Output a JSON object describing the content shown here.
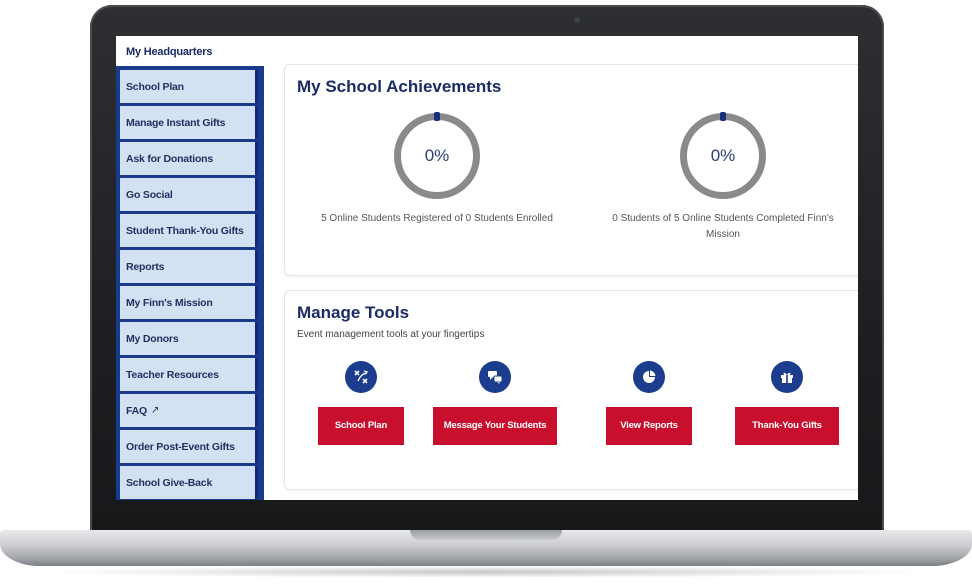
{
  "sidebar": {
    "header": "My Headquarters",
    "items": [
      {
        "label": "School Plan"
      },
      {
        "label": "Manage Instant Gifts"
      },
      {
        "label": "Ask for Donations"
      },
      {
        "label": "Go Social"
      },
      {
        "label": "Student Thank-You Gifts"
      },
      {
        "label": "Reports"
      },
      {
        "label": "My Finn's Mission"
      },
      {
        "label": "My Donors"
      },
      {
        "label": "Teacher Resources"
      },
      {
        "label": "FAQ",
        "icon": "external-link-icon"
      },
      {
        "label": "Order Post-Event Gifts"
      },
      {
        "label": "School Give-Back"
      }
    ]
  },
  "achievements": {
    "title": "My School Achievements",
    "stats": [
      {
        "percent": "0%",
        "label": "5 Online Students Registered of 0 Students Enrolled"
      },
      {
        "percent": "0%",
        "label": "0 Students of 5 Online Students Completed Finn's Mission"
      }
    ]
  },
  "tools": {
    "title": "Manage Tools",
    "subtitle": "Event management tools at your fingertips",
    "items": [
      {
        "label": "School Plan",
        "icon": "strategy-icon"
      },
      {
        "label": "Message Your Students",
        "icon": "chat-bubbles-icon"
      },
      {
        "label": "View Reports",
        "icon": "pie-chart-icon"
      },
      {
        "label": "Thank-You Gifts",
        "icon": "gift-icon"
      }
    ]
  },
  "colors": {
    "brand_navy": "#1c2b66",
    "sidebar_blue": "#1b3a8c",
    "sidebar_item": "#d3e2f2",
    "button_red": "#c8102e",
    "ring_gray": "#8a8a8a"
  }
}
